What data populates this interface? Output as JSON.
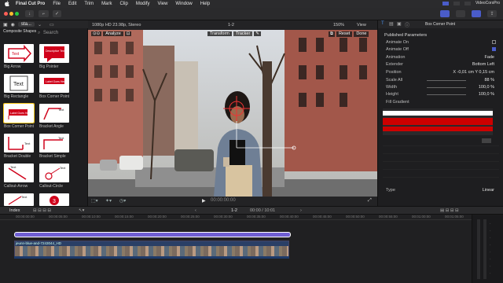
{
  "menubar": {
    "app": "Final Cut Pro",
    "items": [
      "File",
      "Edit",
      "Trim",
      "Mark",
      "Clip",
      "Modify",
      "View",
      "Window",
      "Help"
    ],
    "user": "VideoCorsPro"
  },
  "browser": {
    "library": "sta...",
    "category": "Composite Shapes",
    "search_placeholder": "Search",
    "items": [
      {
        "label": "Big Arrow",
        "thumb_text": "Text"
      },
      {
        "label": "Big Pointer",
        "thumb_text": "Descriptive Text"
      },
      {
        "label": "Big Rectangle",
        "thumb_text": "Text"
      },
      {
        "label": "Box Corner Point",
        "thumb_text": "Label Goes Here"
      },
      {
        "label": "Box Corner Point",
        "thumb_text": "Label Goes Here"
      },
      {
        "label": "Bracket Angle",
        "thumb_text": "Text"
      },
      {
        "label": "Bracket Double",
        "thumb_text": "Text"
      },
      {
        "label": "Bracket Simple",
        "thumb_text": "Text"
      },
      {
        "label": "Callout-Arrow",
        "thumb_text": "Text"
      },
      {
        "label": "Callout-Circle",
        "thumb_text": "Text"
      },
      {
        "label": "",
        "thumb_text": "Text"
      },
      {
        "label": "",
        "thumb_text": "3"
      }
    ]
  },
  "viewer": {
    "format": "1080p HD 23.98p, Stereo",
    "clip_range": "1-2",
    "zoom": "150%",
    "view_label": "View",
    "analyze_label": "Analyze",
    "transform_label": "Transform",
    "tracker_label": "Tracker",
    "reset_label": "Reset",
    "done_label": "Done",
    "timecode": "00:00:00:00"
  },
  "inspector": {
    "title": "Box Corner Point",
    "section": "Published Parameters",
    "rows": [
      {
        "label": "Animate On",
        "value": ""
      },
      {
        "label": "Animate Off",
        "value": ""
      },
      {
        "label": "Animation",
        "value": "Fade"
      },
      {
        "label": "Extender",
        "value": "Bottom Left"
      },
      {
        "label": "Position",
        "value": "X  -0,01  cm    Y  0,15  cm"
      },
      {
        "label": "Scale All",
        "value": "88 %"
      },
      {
        "label": "Width",
        "value": "100,0 %"
      },
      {
        "label": "Height",
        "value": "100,0 %"
      },
      {
        "label": "Fill Gradient",
        "value": ""
      },
      {
        "label": "Type",
        "value": "Linear"
      }
    ],
    "fill_colors": [
      "#ffffff",
      "#cc0000",
      "#cc0000"
    ]
  },
  "timeline": {
    "index_label": "Index",
    "project_range": "1-2",
    "duration": "00:00 / 10:01",
    "clip_name": "jeunn-blue-and-7243044_HD",
    "ruler": [
      "00:00:00:00",
      "00:00:05:00",
      "00:00:10:00",
      "00:00:15:00",
      "00:00:20:00",
      "00:00:25:00",
      "00:00:30:00",
      "00:00:35:00",
      "00:00:40:00",
      "00:00:45:00",
      "00:00:50:00",
      "00:00:55:00",
      "00:01:00:00",
      "00:01:05:00"
    ]
  },
  "colors": {
    "accent": "#2f6fde",
    "purple_clip": "#6f5fd3",
    "fill_red": "#cc0000"
  }
}
